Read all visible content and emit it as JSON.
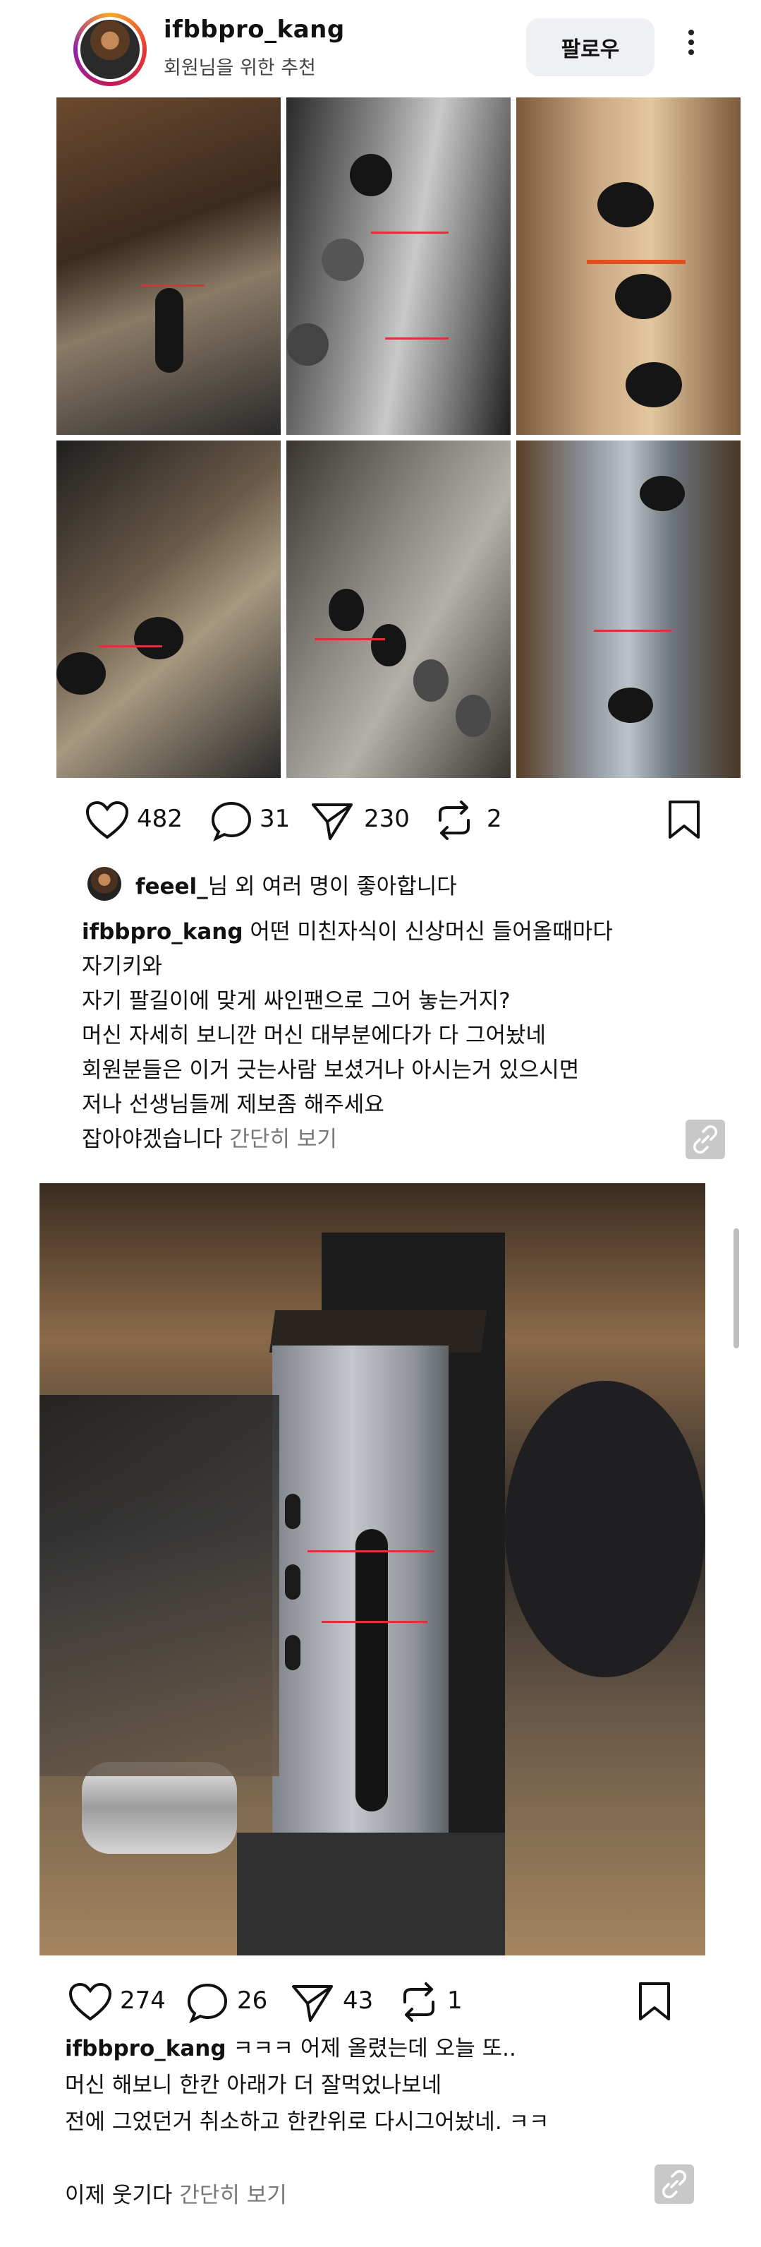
{
  "header": {
    "username": "ifbbpro_kang",
    "subtitle": "회원님을 위한 추천",
    "follow_label": "팔로우"
  },
  "post1": {
    "likes": "482",
    "comments": "31",
    "shares": "230",
    "reposts": "2",
    "liked_by_user": "feeel_",
    "liked_by_rest": "님 외 여러 명이 좋아합니다",
    "caption_user": "ifbbpro_kang",
    "caption_text": " 어떤 미친자식이 신상머신 들어올때마다\n자기키와\n자기 팔길이에 맞게 싸인팬으로 그어 놓는거지?\n머신 자세히 보니깐 머신 대부분에다가 다 그어놨네\n회원분들은 이거 긋는사람 보셨거나 아시는거 있으시면\n저나 선생님들께 제보좀 해주세요\n잡아야겠습니다 ",
    "more_label": "간단히 보기"
  },
  "post2": {
    "likes": "274",
    "comments": "26",
    "shares": "43",
    "reposts": "1",
    "caption_user": "ifbbpro_kang",
    "caption_text": " ㅋㅋㅋ 어제 올렸는데 오늘 또..\n머신 해보니 한칸 아래가 더 잘먹었나보네\n전에 그었던거 취소하고 한칸위로 다시그어놨네. ㅋㅋ\n\n이제 웃기다 ",
    "more_label": "간단히 보기"
  },
  "icons": [
    "heart-icon",
    "comment-icon",
    "send-icon",
    "repost-icon",
    "bookmark-icon",
    "link-icon",
    "more-icon"
  ]
}
